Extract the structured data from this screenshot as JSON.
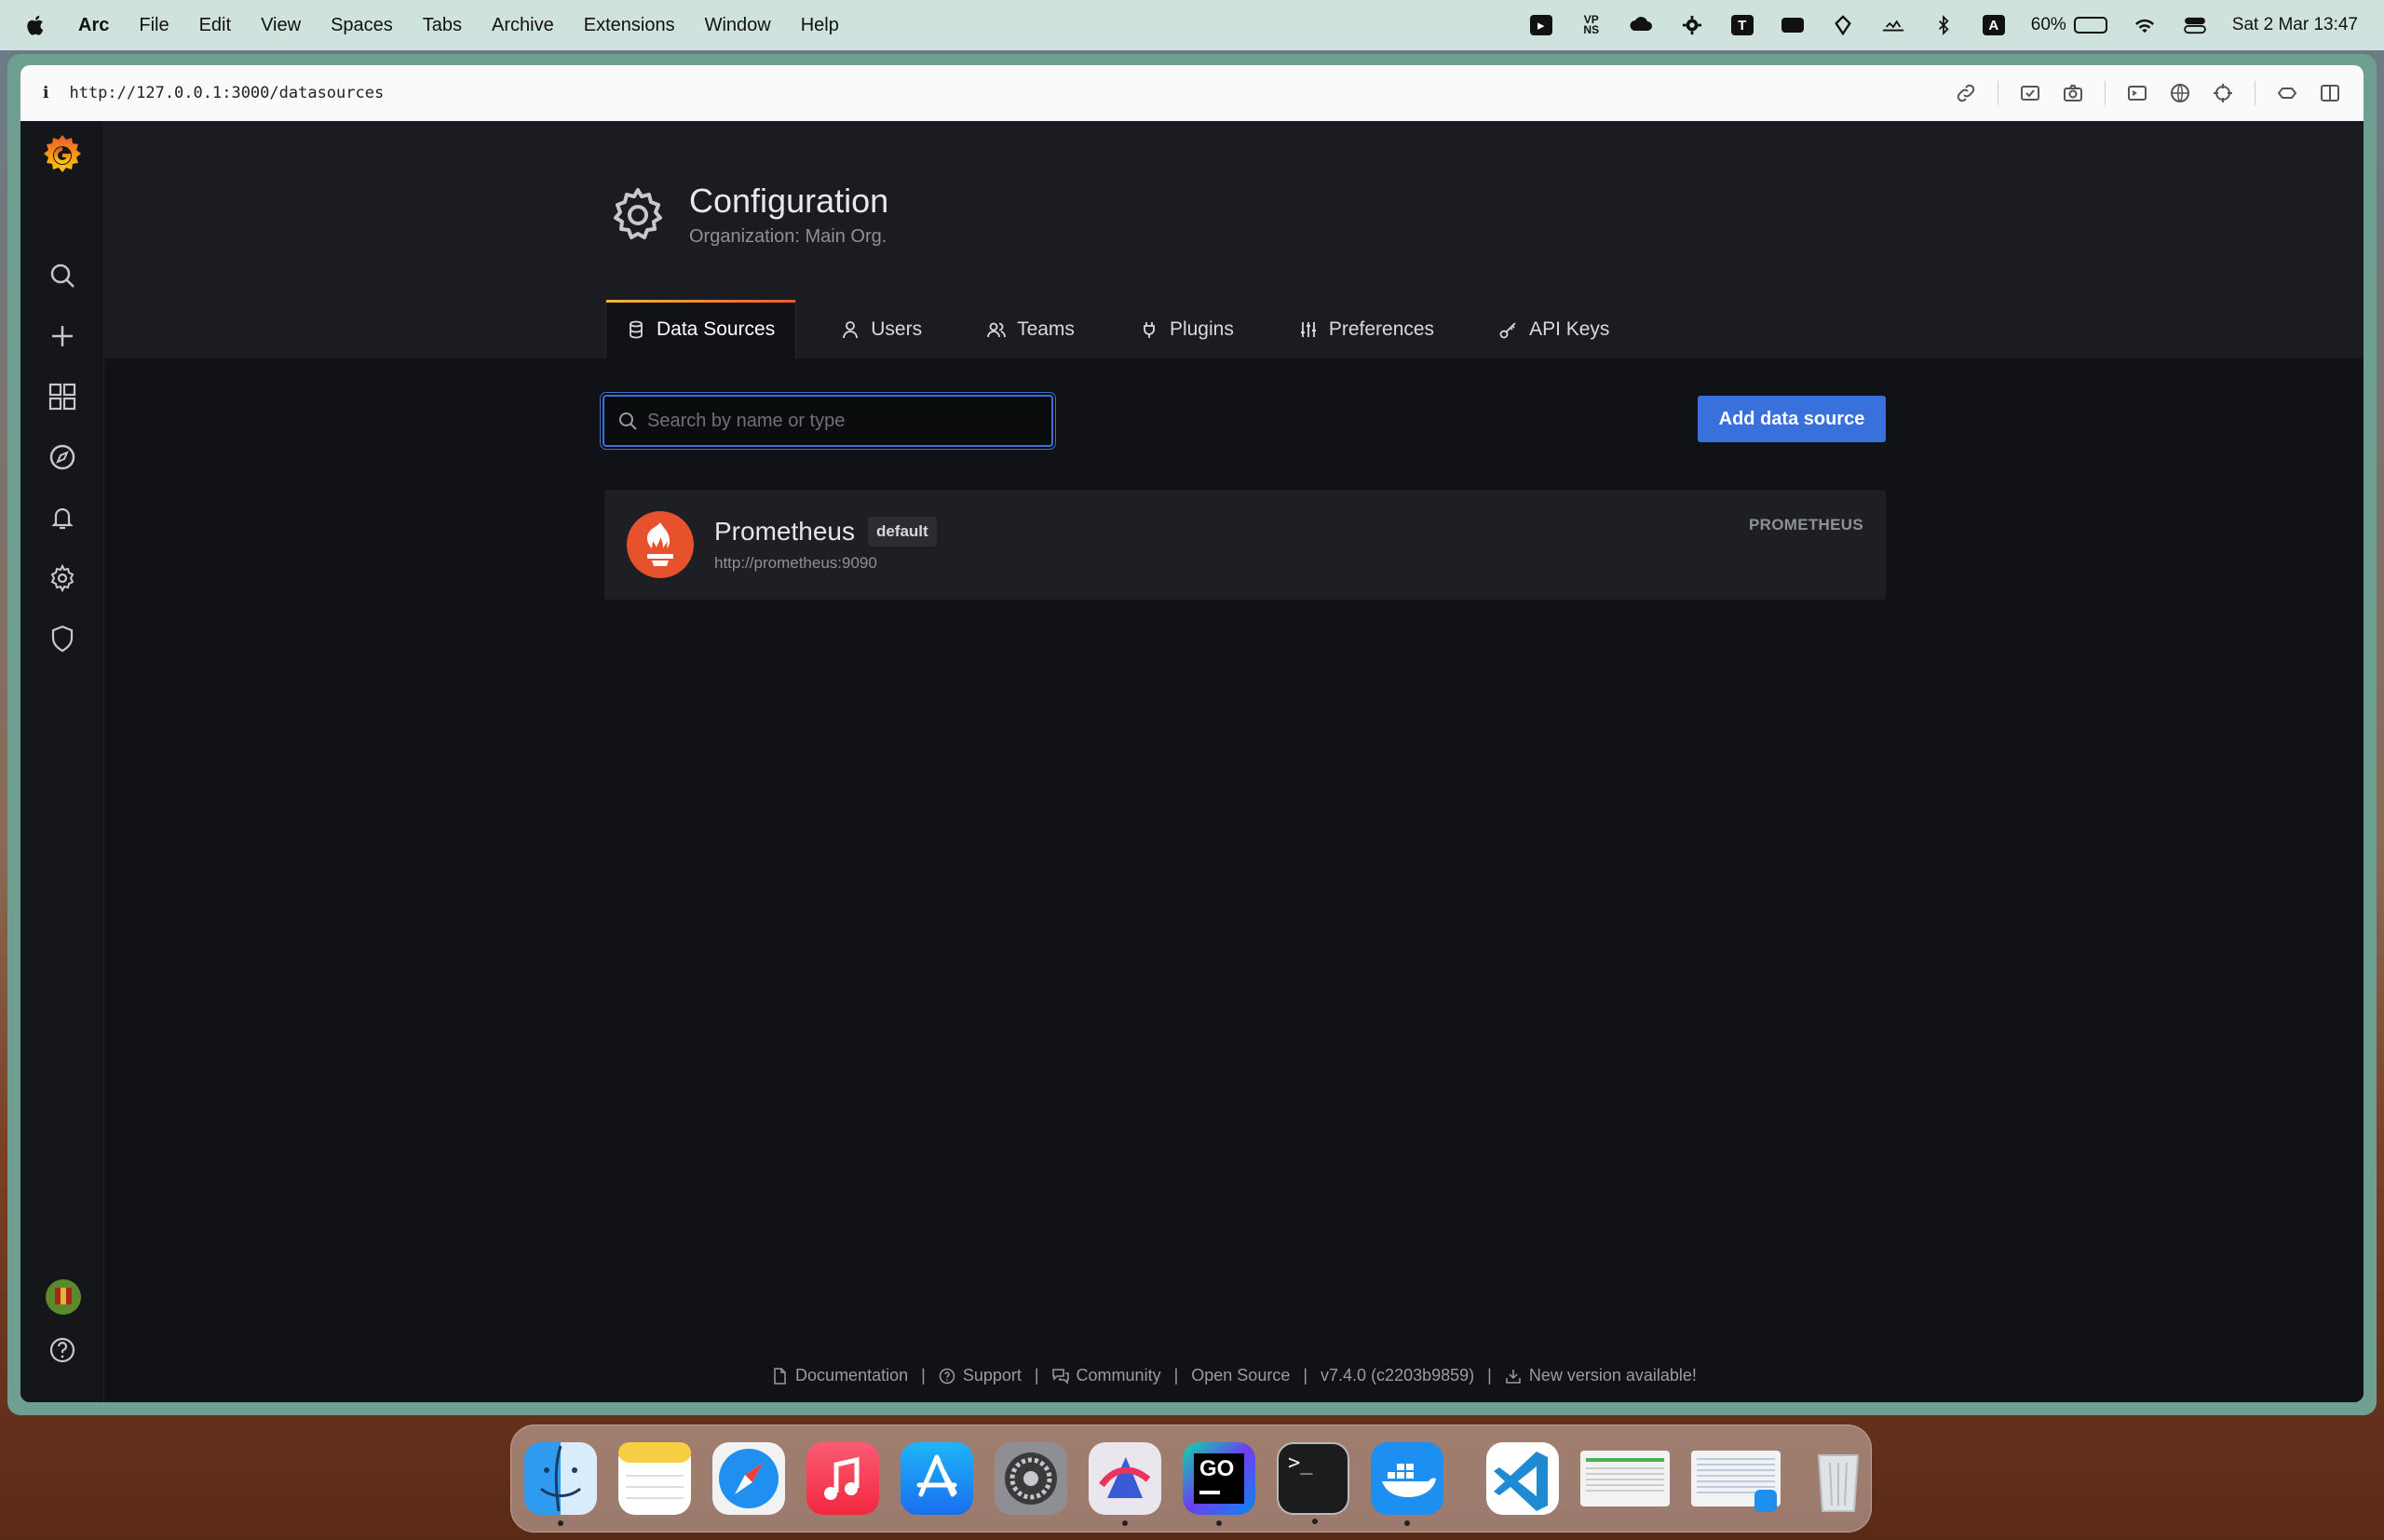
{
  "menubar": {
    "app_name": "Arc",
    "items": [
      "File",
      "Edit",
      "View",
      "Spaces",
      "Tabs",
      "Archive",
      "Extensions",
      "Window",
      "Help"
    ],
    "battery": "60%",
    "battery_level": 0.6,
    "datetime": "Sat 2 Mar  13:47",
    "tray_letter_t": "T",
    "tray_letter_a": "A"
  },
  "browser": {
    "url": "http://127.0.0.1:3000/datasources",
    "info_glyph": "i"
  },
  "page": {
    "title": "Configuration",
    "subtitle": "Organization: Main Org.",
    "tabs": [
      {
        "label": "Data Sources",
        "icon": "database-icon",
        "active": true
      },
      {
        "label": "Users",
        "icon": "user-icon"
      },
      {
        "label": "Teams",
        "icon": "users-icon"
      },
      {
        "label": "Plugins",
        "icon": "plug-icon"
      },
      {
        "label": "Preferences",
        "icon": "sliders-icon"
      },
      {
        "label": "API Keys",
        "icon": "key-icon"
      }
    ],
    "search_placeholder": "Search by name or type",
    "add_button": "Add data source"
  },
  "datasources": [
    {
      "name": "Prometheus",
      "badge": "default",
      "url": "http://prometheus:9090",
      "type": "PROMETHEUS"
    }
  ],
  "footer": {
    "documentation": "Documentation",
    "support": "Support",
    "community": "Community",
    "open_source": "Open Source",
    "version": "v7.4.0 (c2203b9859)",
    "new_version": "New version available!",
    "separator": "|"
  },
  "dock": {
    "apps": [
      "Finder",
      "Notes",
      "Safari",
      "Music",
      "App Store",
      "System Settings",
      "Affinity Designer",
      "GoLand",
      "Terminal",
      "Docker",
      "Visual Studio Code"
    ],
    "goland_label": "GO",
    "terminal_label": ">_"
  },
  "colors": {
    "accent": "#3871dc",
    "prometheus": "#e6522c",
    "grafana_orange": "#f05a28"
  }
}
